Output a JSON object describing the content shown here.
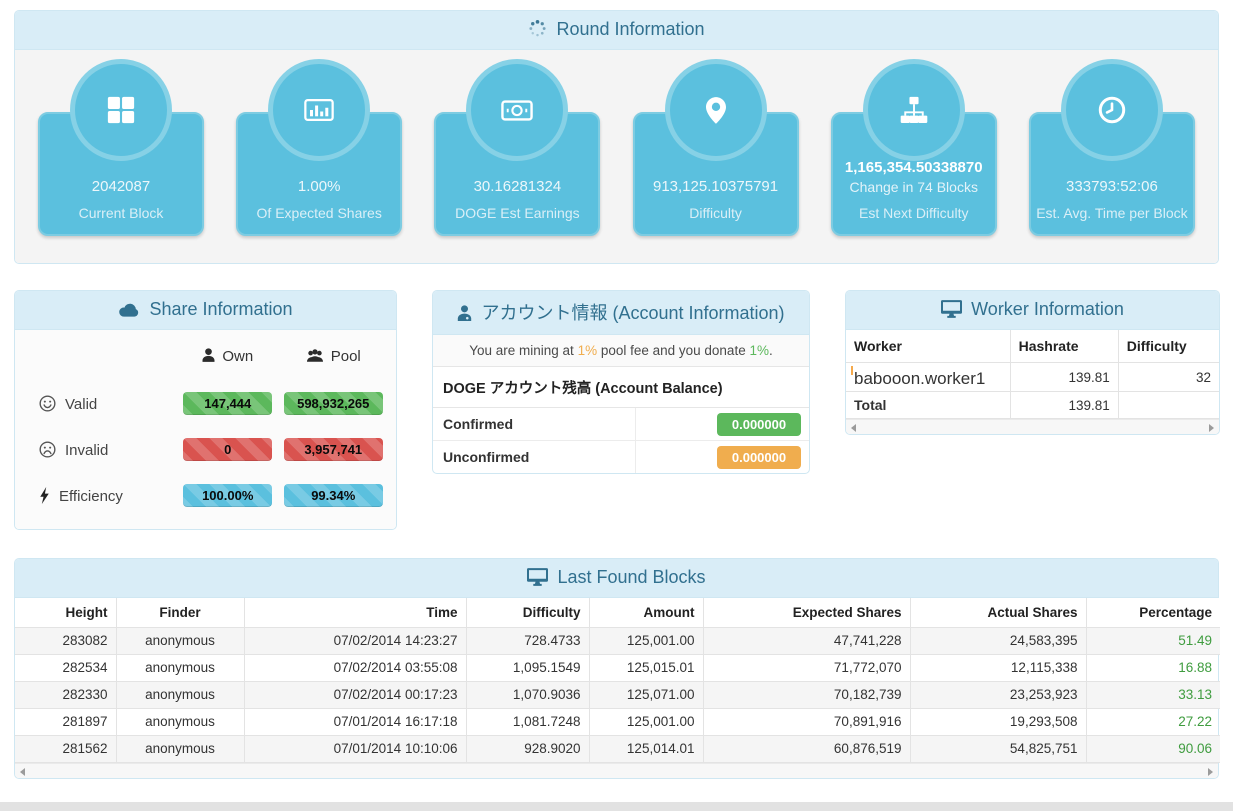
{
  "panels": {
    "round": {
      "title": "Round Information",
      "tiles": [
        {
          "icon": "th-large-icon",
          "value": "2042087",
          "label": "Current Block"
        },
        {
          "icon": "bar-chart-icon",
          "value": "1.00%",
          "label": "Of Expected Shares"
        },
        {
          "icon": "money-icon",
          "value": "30.16281324",
          "label": "DOGE Est Earnings"
        },
        {
          "icon": "map-marker-icon",
          "value": "913,125.10375791",
          "label": "Difficulty"
        },
        {
          "icon": "sitemap-icon",
          "value": "1,165,354.50338870",
          "subvalue": "Change in 74 Blocks",
          "label": "Est Next Difficulty"
        },
        {
          "icon": "clock-icon",
          "value": "333793:52:06",
          "label": "Est. Avg. Time per Block"
        }
      ]
    },
    "share": {
      "title": "Share Information",
      "columns": {
        "own": "Own",
        "pool": "Pool"
      },
      "rows": [
        {
          "label": "Valid",
          "own": "147,444",
          "pool": "598,932,265",
          "color": "green"
        },
        {
          "label": "Invalid",
          "own": "0",
          "pool": "3,957,741",
          "color": "red"
        },
        {
          "label": "Efficiency",
          "own": "100.00%",
          "pool": "99.34%",
          "color": "blue"
        }
      ]
    },
    "account": {
      "title": "アカウント情報 (Account Information)",
      "fee_notice": {
        "prefix": "You are mining at ",
        "fee": "1%",
        "middle": " pool fee and you donate ",
        "donate": "1%",
        "suffix": "."
      },
      "balance_header": "DOGE アカウント残高 (Account Balance)",
      "rows": [
        {
          "label": "Confirmed",
          "value": "0.000000",
          "color": "green"
        },
        {
          "label": "Unconfirmed",
          "value": "0.000000",
          "color": "orange"
        }
      ]
    },
    "worker": {
      "title": "Worker Information",
      "headers": [
        "Worker",
        "Hashrate",
        "Difficulty"
      ],
      "rows": [
        [
          "babooon.worker1",
          "139.81",
          "32"
        ],
        [
          "Total",
          "139.81",
          ""
        ]
      ]
    },
    "blocks": {
      "title": "Last Found Blocks",
      "headers": [
        "Height",
        "Finder",
        "Time",
        "Difficulty",
        "Amount",
        "Expected Shares",
        "Actual Shares",
        "Percentage"
      ],
      "rows": [
        [
          "283082",
          "anonymous",
          "07/02/2014 14:23:27",
          "728.4733",
          "125,001.00",
          "47,741,228",
          "24,583,395",
          "51.49"
        ],
        [
          "282534",
          "anonymous",
          "07/02/2014 03:55:08",
          "1,095.1549",
          "125,015.01",
          "71,772,070",
          "12,115,338",
          "16.88"
        ],
        [
          "282330",
          "anonymous",
          "07/02/2014 00:17:23",
          "1,070.9036",
          "125,071.00",
          "70,182,739",
          "23,253,923",
          "33.13"
        ],
        [
          "281897",
          "anonymous",
          "07/01/2014 16:17:18",
          "1,081.7248",
          "125,001.00",
          "70,891,916",
          "19,293,508",
          "27.22"
        ],
        [
          "281562",
          "anonymous",
          "07/01/2014 10:10:06",
          "928.9020",
          "125,014.01",
          "60,876,519",
          "54,825,751",
          "90.06"
        ]
      ]
    }
  },
  "colors": {
    "accent": "#5bc0de",
    "panel_heading_bg": "#d9edf7",
    "panel_heading_text": "#31708f",
    "valid_badge": "#5cb85c",
    "invalid_badge": "#d9534f",
    "efficiency_badge": "#5bc0de",
    "confirmed_badge": "#5cb85c",
    "unconfirmed_badge": "#f0ad4e",
    "percentage_text": "#3f9c3f"
  }
}
